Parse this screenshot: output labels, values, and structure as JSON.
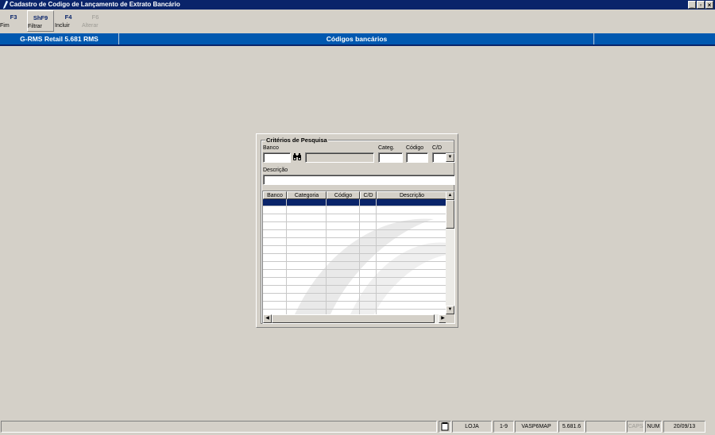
{
  "window": {
    "title": "Cadastro de Codigo de Lançamento de Extrato Bancário",
    "icon": "app-icon",
    "controls": {
      "minimize": "_",
      "maximize": "▫",
      "close": "×"
    }
  },
  "toolbar": {
    "buttons": [
      {
        "key": "F3",
        "label": "Fim",
        "enabled": true,
        "pressed": false
      },
      {
        "key": "ShF9",
        "label": "Filtrar",
        "enabled": true,
        "pressed": true
      },
      {
        "key": "F4",
        "label": "Incluir",
        "enabled": true,
        "pressed": false
      },
      {
        "key": "F6",
        "label": "Alterar",
        "enabled": false,
        "pressed": false
      }
    ]
  },
  "header": {
    "app_version": "G-RMS Retail 5.681 RMS",
    "screen_title": "Códigos bancários",
    "band_color": "#0058b0"
  },
  "search": {
    "group_title": "Critérios de Pesquisa",
    "banco_label": "Banco",
    "banco_value": "",
    "banco_name_value": "",
    "lookup_icon": "binoculars-icon",
    "categ_label": "Categ.",
    "categ_value": "",
    "codigo_label": "Código",
    "codigo_value": "",
    "cd_label": "C/D",
    "cd_value": "",
    "descricao_label": "Descrição",
    "descricao_value": ""
  },
  "grid": {
    "columns": [
      "Banco",
      "Categoria",
      "Código",
      "C/D",
      "Descrição"
    ],
    "rows": [],
    "selected_row_color": "#0a246a"
  },
  "statusbar": {
    "message": "",
    "icon": "document-icon",
    "loja": "LOJA",
    "range": "1-9",
    "server": "VASP6MAP",
    "version": "5.681.6",
    "extra": "",
    "caps": "CAPS",
    "num": "NUM",
    "date": "20/09/13"
  }
}
